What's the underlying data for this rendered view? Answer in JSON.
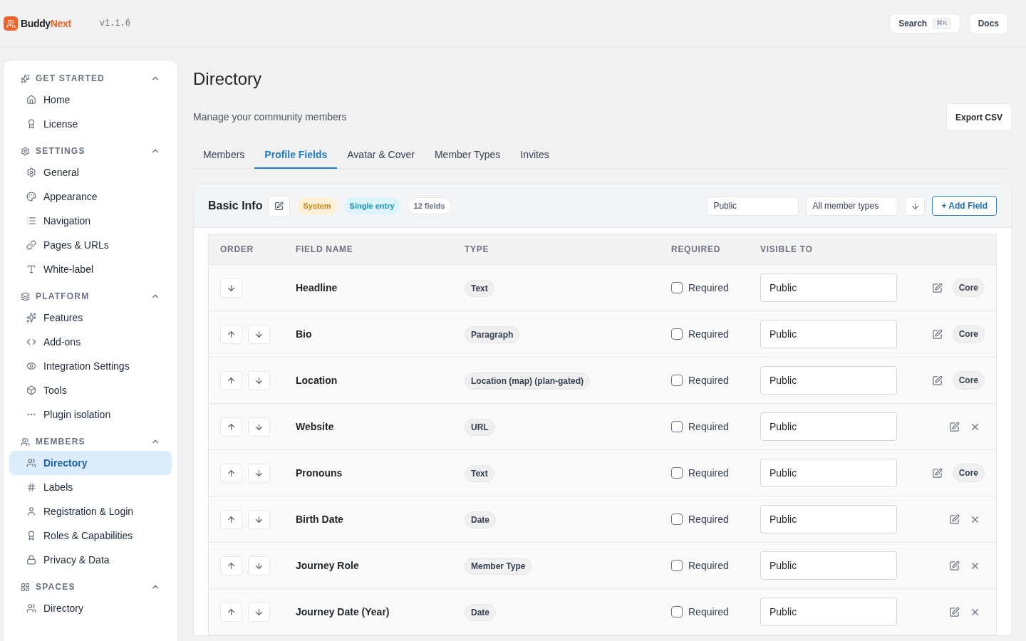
{
  "header": {
    "brand_first": "Buddy",
    "brand_second": "Next",
    "version": "v1.1.6",
    "search": "Search",
    "search_shortcut": "⌘K",
    "docs": "Docs"
  },
  "sidebar": [
    {
      "title": "GET STARTED",
      "expanded": true,
      "items": [
        {
          "label": "Home",
          "selected": false
        },
        {
          "label": "License",
          "selected": false
        }
      ]
    },
    {
      "title": "SETTINGS",
      "expanded": true,
      "items": [
        {
          "label": "General",
          "selected": false
        },
        {
          "label": "Appearance",
          "selected": false
        },
        {
          "label": "Navigation",
          "selected": false
        },
        {
          "label": "Pages & URLs",
          "selected": false
        },
        {
          "label": "White-label",
          "selected": false
        }
      ]
    },
    {
      "title": "PLATFORM",
      "expanded": true,
      "items": [
        {
          "label": "Features",
          "selected": false
        },
        {
          "label": "Add-ons",
          "selected": false
        },
        {
          "label": "Integration Settings",
          "selected": false
        },
        {
          "label": "Tools",
          "selected": false
        },
        {
          "label": "Plugin isolation",
          "selected": false
        }
      ]
    },
    {
      "title": "MEMBERS",
      "expanded": true,
      "items": [
        {
          "label": "Directory",
          "selected": true
        },
        {
          "label": "Labels",
          "selected": false
        },
        {
          "label": "Registration & Login",
          "selected": false
        },
        {
          "label": "Roles & Capabilities",
          "selected": false
        },
        {
          "label": "Privacy & Data",
          "selected": false
        }
      ]
    },
    {
      "title": "SPACES",
      "expanded": true,
      "items": [
        {
          "label": "Directory",
          "selected": false
        }
      ]
    }
  ],
  "page": {
    "title": "Directory",
    "subtitle": "Manage your community members",
    "export": "Export CSV"
  },
  "tabs": [
    {
      "label": "Members",
      "selected": false
    },
    {
      "label": "Profile Fields",
      "selected": true
    },
    {
      "label": "Avatar & Cover",
      "selected": false
    },
    {
      "label": "Member Types",
      "selected": false
    },
    {
      "label": "Invites",
      "selected": false
    }
  ],
  "group": {
    "title": "Basic Info",
    "badges": [
      {
        "label": "System",
        "kind": "system"
      },
      {
        "label": "Single entry",
        "kind": "single"
      },
      {
        "label": "12 fields",
        "kind": "count"
      }
    ],
    "visibility": "Public",
    "member_types": "All member types",
    "add": "+ Add Field"
  },
  "table": {
    "columns": [
      "ORDER",
      "FIELD NAME",
      "TYPE",
      "REQUIRED",
      "VISIBLE TO"
    ],
    "rows": [
      {
        "name": "Headline",
        "type": "Text",
        "required": false,
        "required_label": "Required",
        "visible": "Public",
        "kind": "core",
        "badge": "Core",
        "can_move_up": false
      },
      {
        "name": "Bio",
        "type": "Paragraph",
        "required": false,
        "required_label": "Required",
        "visible": "Public",
        "kind": "core",
        "badge": "Core",
        "can_move_up": true
      },
      {
        "name": "Location",
        "type": "Location (map) (plan-gated)",
        "required": false,
        "required_label": "Required",
        "visible": "Public",
        "kind": "core",
        "badge": "Core",
        "can_move_up": true
      },
      {
        "name": "Website",
        "type": "URL",
        "required": false,
        "required_label": "Required",
        "visible": "Public",
        "kind": "custom",
        "can_move_up": true
      },
      {
        "name": "Pronouns",
        "type": "Text",
        "required": false,
        "required_label": "Required",
        "visible": "Public",
        "kind": "core",
        "badge": "Core",
        "can_move_up": true
      },
      {
        "name": "Birth Date",
        "type": "Date",
        "required": false,
        "required_label": "Required",
        "visible": "Public",
        "kind": "custom",
        "can_move_up": true
      },
      {
        "name": "Journey Role",
        "type": "Member Type",
        "required": false,
        "required_label": "Required",
        "visible": "Public",
        "kind": "custom",
        "can_move_up": true
      },
      {
        "name": "Journey Date (Year)",
        "type": "Date",
        "required": false,
        "required_label": "Required",
        "visible": "Public",
        "kind": "custom",
        "can_move_up": true
      }
    ]
  }
}
